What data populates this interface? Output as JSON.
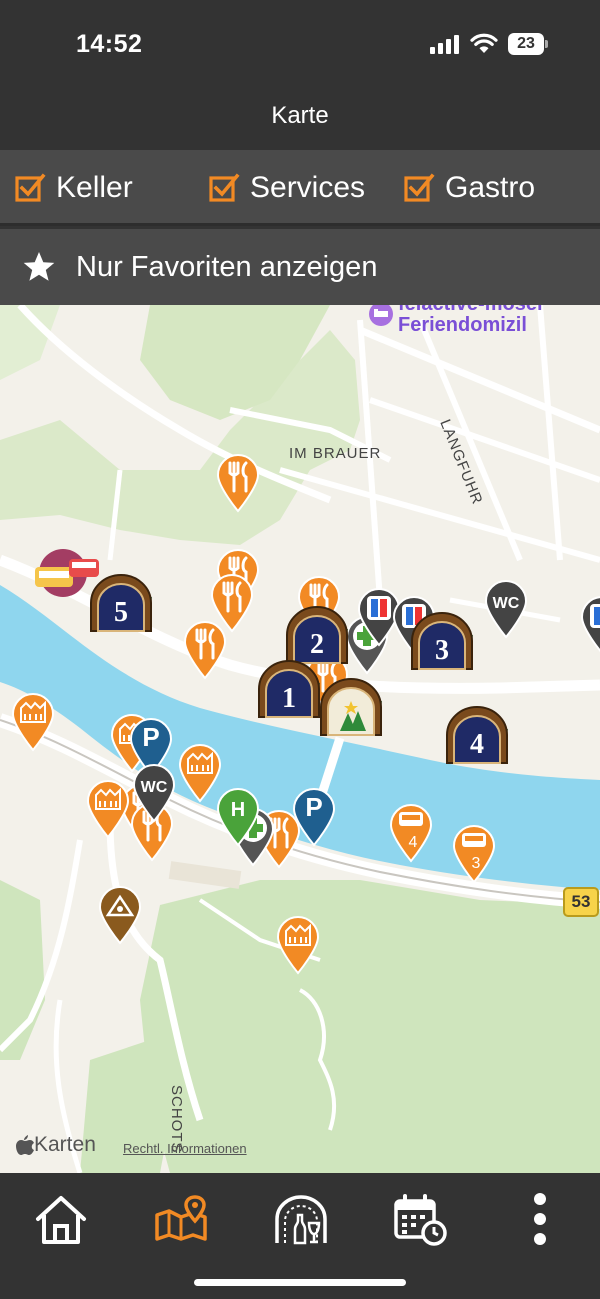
{
  "status": {
    "time": "14:52",
    "battery": "23"
  },
  "header": {
    "title": "Karte"
  },
  "filters": [
    {
      "label": "Keller",
      "checked": true
    },
    {
      "label": "Services",
      "checked": true
    },
    {
      "label": "Gastro",
      "checked": true
    }
  ],
  "favorites": {
    "label": "Nur Favoriten anzeigen"
  },
  "map": {
    "streets": {
      "im_brauer": "IM BRAUER",
      "langfuhr": "LANGFUHR",
      "schots": "SCHOTS"
    },
    "poi": {
      "line1": "felactive-mosel",
      "line2": "Feriendomizil"
    },
    "road_shield": "53",
    "attribution": "Karten",
    "legal": "Rechtl. Informationen",
    "cellars": [
      "1",
      "2",
      "3",
      "4",
      "5"
    ],
    "parking_label": "P",
    "wc_label": "WC",
    "bus_stop_label": "H",
    "bus_parking": [
      "4",
      "3"
    ]
  },
  "colors": {
    "accent": "#f28a24",
    "bar": "#333333",
    "filter_bg": "#4a4a4a",
    "water": "#8fd6ee",
    "park": "#d7e8c5",
    "parking_pin": "#1f5f8f",
    "pharmacy": "#4aa33a"
  },
  "tabs": [
    {
      "name": "home",
      "active": false
    },
    {
      "name": "map",
      "active": true
    },
    {
      "name": "cellar",
      "active": false
    },
    {
      "name": "events",
      "active": false
    },
    {
      "name": "more",
      "active": false
    }
  ]
}
